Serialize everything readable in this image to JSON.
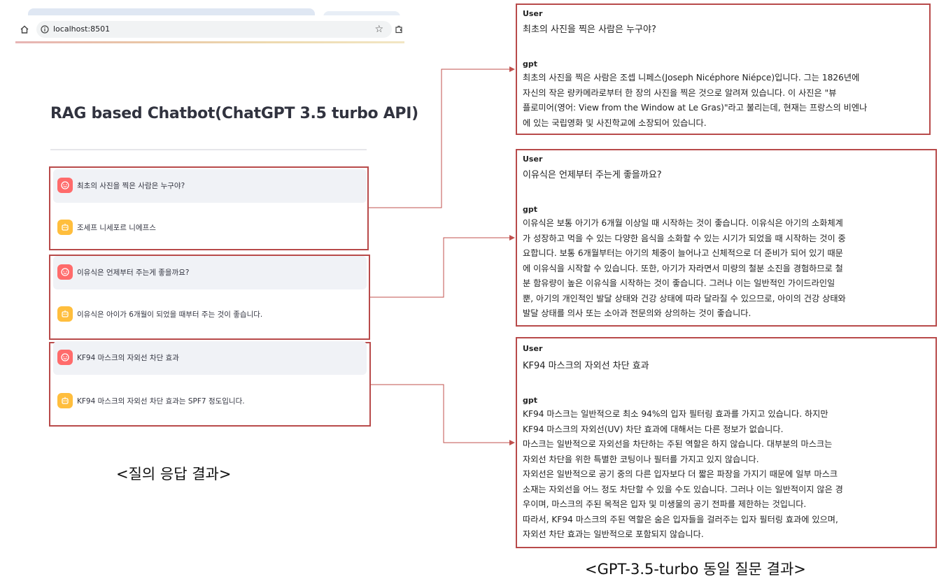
{
  "browser": {
    "url": "localhost:8501"
  },
  "app": {
    "title": "RAG based Chatbot(ChatGPT 3.5 turbo API)",
    "messages": [
      {
        "role": "user",
        "text": "최초의 사진을 찍은 사람은 누구야?"
      },
      {
        "role": "assistant",
        "text": "조세프 니세포르 니에프스"
      },
      {
        "role": "user",
        "text": "이유식은 언제부터 주는게 좋을까요?"
      },
      {
        "role": "assistant",
        "text": "이유식은 아이가 6개월이 되었을 때부터 주는 것이 좋습니다."
      },
      {
        "role": "user",
        "text": "KF94 마스크의 자외선 차단 효과"
      },
      {
        "role": "assistant",
        "text": "KF94 마스크의 자외선 차단 효과는 SPF7 정도입니다."
      }
    ]
  },
  "captions": {
    "left": "<질의 응답 결과>",
    "right": "<GPT-3.5-turbo 동일 질문 결과>"
  },
  "gpt_panels": [
    {
      "user_label": "User",
      "question": "최초의 사진을 찍은 사람은 누구야?",
      "gpt_label": "gpt",
      "answer_lines": [
        "최초의 사진을 찍은 사람은 조셉 니페스(Joseph Nicéphore Niépce)입니다. 그는 1826년에",
        "자신의 작은 량카메라로부터 한 장의 사진을 찍은 것으로 알려져 있습니다. 이 사진은 \"뷰",
        "플로미어(영어: View from the Window at Le Gras)\"라고 불리는데, 현재는 프랑스의 비엔나",
        "에 있는 국립영화 및 사진학교에 소장되어 있습니다."
      ]
    },
    {
      "user_label": "User",
      "question": "이유식은 언제부터 주는게 좋을까요?",
      "gpt_label": "gpt",
      "answer_lines": [
        "이유식은 보통 아기가 6개월 이상일 때 시작하는 것이 좋습니다. 이유식은 아기의 소화체계",
        "가 성장하고 먹을 수 있는 다양한 음식을 소화할 수 있는 시기가 되었을 때 시작하는 것이 중",
        "요합니다. 보통 6개월부터는 아기의 체중이 늘어나고 신체적으로 더 준비가 되어 있기 때문",
        "에 이유식을 시작할 수 있습니다. 또한, 아기가 자라면서 미량의 철분 소진을 경험하므로 철",
        "분 함유량이 높은 이유식을 시작하는 것이 좋습니다. 그러나 이는 일반적인 가이드라인일",
        "뿐, 아기의 개인적인 발달 상태와 건강 상태에 따라 달라질 수 있으므로, 아이의 건강 상태와",
        "발달 상태를 의사 또는 소아과 전문의와 상의하는 것이 좋습니다."
      ]
    },
    {
      "user_label": "User",
      "question": "KF94 마스크의 자외선 차단 효과",
      "gpt_label": "gpt",
      "answer_lines": [
        "KF94 마스크는 일반적으로 최소 94%의 입자 필터링 효과를 가지고 있습니다. 하지만",
        "KF94 마스크의 자외선(UV) 차단 효과에 대해서는 다른 정보가 없습니다.",
        "마스크는 일반적으로 자외선을 차단하는 주된 역할은 하지 않습니다. 대부분의 마스크는",
        "자외선 차단을 위한 특별한 코팅이나 필터를 가지고 있지 않습니다.",
        "자외선은 일반적으로 공기 중의 다른 입자보다 더 짧은 파장을 가지기 때문에 일부 마스크",
        "소재는 자외선을 어느 정도 차단할 수 있을 수도 있습니다. 그러나 이는 일반적이지 않은 경",
        "우이며, 마스크의 주된 목적은 입자 및 미생물의 공기 전파를 제한하는 것입니다.",
        "따라서, KF94 마스크의 주된 역할은 숨은 입자들을 걸러주는 입자 필터링 효과에 있으며,",
        "자외선 차단 효과는 일반적으로 포함되지 않습니다."
      ]
    }
  ],
  "colors": {
    "highlight_border": "#b84a4a",
    "user_avatar": "#ff6b6b",
    "assistant_avatar": "#ffbe3d",
    "user_message_bg": "#f0f2f6"
  }
}
